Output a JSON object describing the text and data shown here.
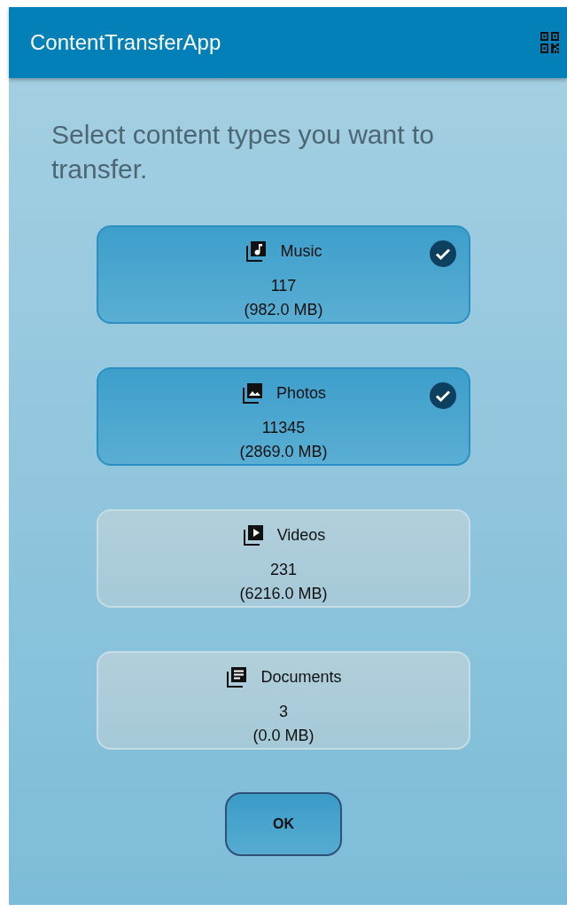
{
  "app_bar": {
    "title": "ContentTransferApp"
  },
  "prompt": "Select content types you want to transfer.",
  "content_types": [
    {
      "kind": "music",
      "label": "Music",
      "count": "117",
      "size": "(982.0 MB)",
      "selected": true
    },
    {
      "kind": "photos",
      "label": "Photos",
      "count": "11345",
      "size": "(2869.0 MB)",
      "selected": true
    },
    {
      "kind": "videos",
      "label": "Videos",
      "count": "231",
      "size": "(6216.0 MB)",
      "selected": false
    },
    {
      "kind": "documents",
      "label": "Documents",
      "count": "3",
      "size": "(0.0 MB)",
      "selected": false
    }
  ],
  "ok_button": {
    "label": "OK"
  }
}
